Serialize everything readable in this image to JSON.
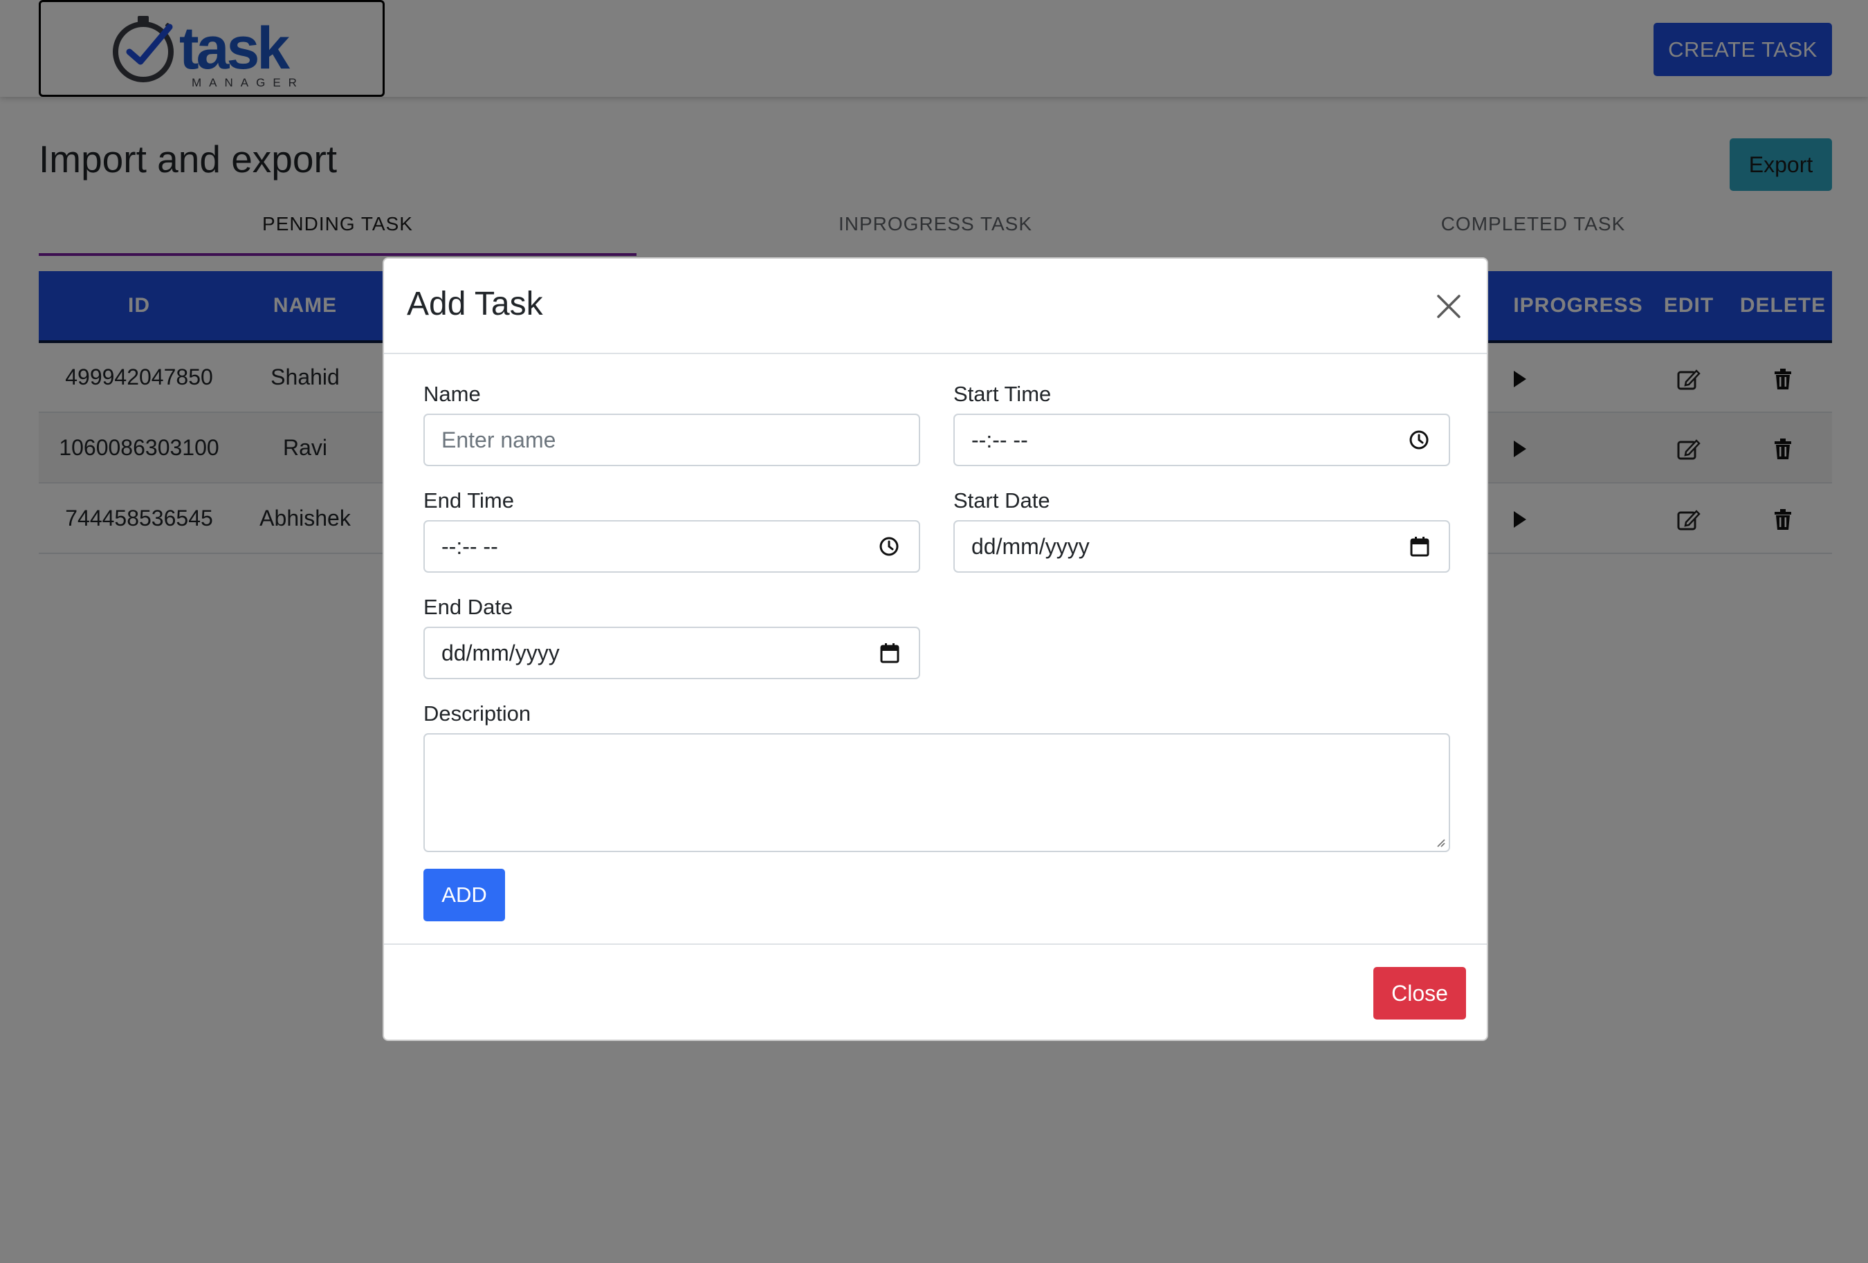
{
  "navbar": {
    "logo": {
      "word": "task",
      "subtitle": "MANAGER",
      "icon": "stopwatch-check-icon"
    },
    "create_task_label": "CREATE TASK"
  },
  "page": {
    "title": "Import and export",
    "export_label": "Export"
  },
  "tabs": [
    {
      "label": "PENDING TASK",
      "active": true
    },
    {
      "label": "INPROGRESS TASK",
      "active": false
    },
    {
      "label": "COMPLETED TASK",
      "active": false
    }
  ],
  "table": {
    "columns": [
      "ID",
      "NAME",
      "INPROGRESS",
      "EDIT",
      "DELETE"
    ],
    "visible_header_fragment": "IPROGRESS",
    "rows": [
      {
        "id": "499942047850",
        "name": "Shahid"
      },
      {
        "id": "1060086303100",
        "name": "Ravi"
      },
      {
        "id": "744458536545",
        "name": "Abhishek"
      }
    ],
    "row_icons": [
      "arrow-right-icon",
      "edit-icon",
      "trash-icon"
    ]
  },
  "modal": {
    "title": "Add Task",
    "fields": {
      "name": {
        "label": "Name",
        "placeholder": "Enter name",
        "value": ""
      },
      "start_time": {
        "label": "Start Time",
        "value": "--:-- --",
        "icon": "clock-icon"
      },
      "end_time": {
        "label": "End Time",
        "value": "--:-- --",
        "icon": "clock-icon"
      },
      "start_date": {
        "label": "Start Date",
        "value": "dd/mm/yyyy",
        "icon": "calendar-icon"
      },
      "end_date": {
        "label": "End Date",
        "value": "dd/mm/yyyy",
        "icon": "calendar-icon"
      },
      "description": {
        "label": "Description",
        "value": ""
      }
    },
    "add_label": "ADD",
    "close_label": "Close"
  },
  "colors": {
    "primary": "#1f4ee0",
    "info": "#2fa7c2",
    "danger": "#dc3545",
    "tab_indicator": "#7b1fa2",
    "backdrop": "rgba(0,0,0,0.5)"
  }
}
